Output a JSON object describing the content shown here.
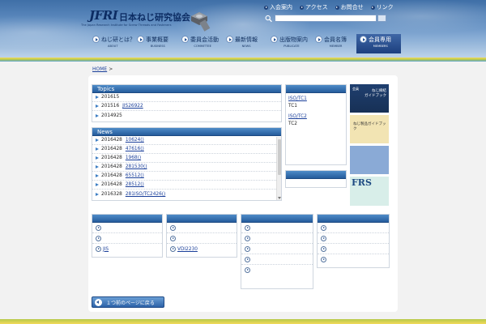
{
  "header": {
    "logo_mark": "JFRI",
    "logo_jp": "日本ねじ研究協会",
    "logo_en": "The Japan Research Institute for Screw Threads and Fasteners",
    "top_links": [
      "入会案内",
      "アクセス",
      "お問合せ",
      "リンク"
    ],
    "search_placeholder": ""
  },
  "nav": [
    {
      "jp": "ねじ研とは？",
      "en": "ABOUT"
    },
    {
      "jp": "事業概要",
      "en": "BUSINESS"
    },
    {
      "jp": "委員会活動",
      "en": "COMMITTEE"
    },
    {
      "jp": "最新情報",
      "en": "NEWS"
    },
    {
      "jp": "出版物案内",
      "en": "PUBLICATE"
    },
    {
      "jp": "会員名簿",
      "en": "MEMBER"
    },
    {
      "jp": "会員専用",
      "en": "MEMBERS"
    }
  ],
  "breadcrumb": {
    "home": "HOME",
    "sep": ">"
  },
  "topics": {
    "title": "Topics",
    "rows": [
      {
        "date": "201615",
        "link": ""
      },
      {
        "date": "201516",
        "link": "JIS26922"
      },
      {
        "date": "2014925",
        "link": ""
      }
    ]
  },
  "news": {
    "title": "News",
    "rows": [
      {
        "date": "2016428",
        "link": "10624()"
      },
      {
        "date": "2016428",
        "link": "47616()"
      },
      {
        "date": "2016428",
        "link": "1968()"
      },
      {
        "date": "2016428",
        "link": "281530()"
      },
      {
        "date": "2016428",
        "link": "65512()"
      },
      {
        "date": "2016428",
        "link": "28512()"
      },
      {
        "date": "2016328",
        "link": "281ISO/TC2426()"
      }
    ]
  },
  "iso": {
    "lines": [
      {
        "link": "ISO/TC1",
        "text": "TC1"
      },
      {
        "link": "ISO/TC2",
        "text": "TC2"
      }
    ]
  },
  "books": {
    "b1_a": "会員",
    "b1_b": "ねじ締結",
    "b1_c": "ガイドブック",
    "b2_a": "ねじ製品ガイドブック",
    "b2_b": "",
    "b3_a": "",
    "b4_a": "FRS",
    "b4_b": ""
  },
  "bottom_boxes": [
    {
      "rows": [
        "",
        "",
        "JIS"
      ]
    },
    {
      "rows": [
        "",
        "",
        "VDI2230"
      ]
    },
    {
      "rows": [
        "",
        "",
        "",
        "",
        ""
      ]
    },
    {
      "rows": [
        "",
        "",
        "",
        ""
      ]
    }
  ],
  "back_button": "１つ前のページに戻る"
}
